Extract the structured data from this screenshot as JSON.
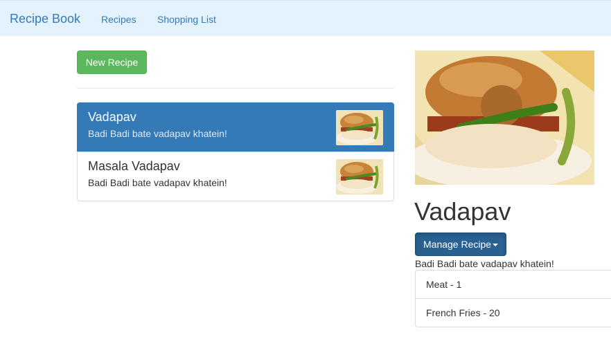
{
  "navbar": {
    "brand": "Recipe Book",
    "links": [
      "Recipes",
      "Shopping List"
    ]
  },
  "actions": {
    "new_recipe": "New Recipe"
  },
  "recipes": [
    {
      "name": "Vadapav",
      "description": "Badi Badi bate vadapav khatein!",
      "active": true
    },
    {
      "name": "Masala Vadapav",
      "description": "Badi Badi bate vadapav khatein!",
      "active": false
    }
  ],
  "detail": {
    "title": "Vadapav",
    "manage_label": "Manage Recipe",
    "description": "Badi Badi bate vadapav khatein!",
    "ingredients": [
      "Meat - 1",
      "French Fries - 20"
    ]
  },
  "colors": {
    "navbar_bg": "#e3f2fd",
    "link": "#337ab7",
    "success": "#5cb85c",
    "active_item": "#337ab7",
    "manage_button": "#286090"
  },
  "icons": [
    "caret-down-icon"
  ]
}
